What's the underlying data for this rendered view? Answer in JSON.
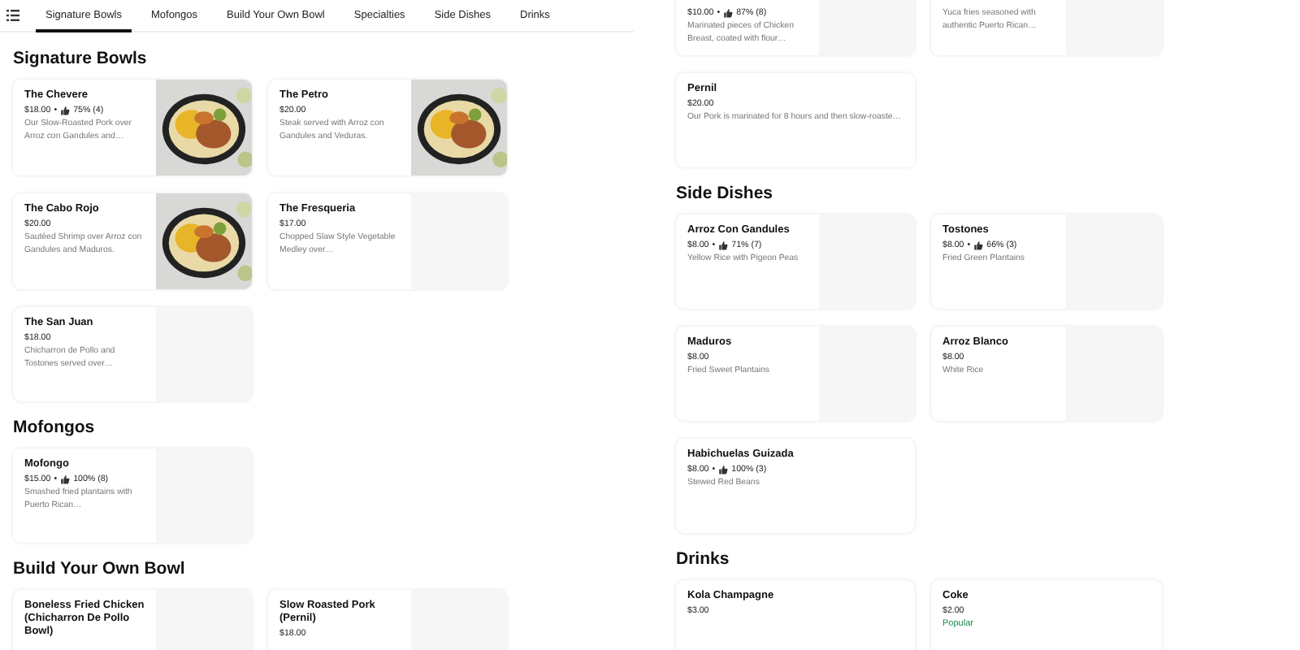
{
  "tabs": [
    {
      "label": "Signature Bowls",
      "selected": true
    },
    {
      "label": "Mofongos",
      "selected": false
    },
    {
      "label": "Build Your Own Bowl",
      "selected": false
    },
    {
      "label": "Specialties",
      "selected": false
    },
    {
      "label": "Side Dishes",
      "selected": false
    },
    {
      "label": "Drinks",
      "selected": false
    }
  ],
  "left_column": {
    "sections": [
      {
        "heading": "Signature Bowls",
        "items": [
          {
            "title": "The Chevere",
            "price": "$18.00",
            "separator": "•",
            "rating": "75% (4)",
            "description": "Our Slow-Roasted Pork over Arroz con Gandules and…"
          },
          {
            "title": "The Petro",
            "price": "$20.00",
            "description": "Steak served with Arroz con Gandules and Veduras."
          },
          {
            "title": "The Cabo Rojo",
            "price": "$20.00",
            "description": "Sautéed Shrimp over Arroz con Gandules and Maduros."
          },
          {
            "kind": "placeholder",
            "title": "The Fresqueria",
            "price": "$17.00",
            "description": "Chopped Slaw Style Vegetable Medley over…"
          },
          {
            "kind": "placeholder",
            "title": "The San Juan",
            "price": "$18.00",
            "description": "Chicharron de Pollo and Tostones served over…"
          }
        ]
      },
      {
        "heading": "Mofongos",
        "items": [
          {
            "kind": "placeholder",
            "title": "Mofongo",
            "price": "$15.00",
            "separator": "•",
            "rating": "100% (8)",
            "description": "Smashed fried plantains with Puerto Rican…"
          }
        ]
      },
      {
        "heading": "Build Your Own Bowl",
        "items": [
          {
            "kind": "placeholder",
            "title": "Boneless Fried Chicken (Chicharron De Pollo Bowl)"
          },
          {
            "kind": "placeholder",
            "title": "Slow Roasted Pork (Pernil)",
            "price": "$18.00"
          }
        ]
      }
    ]
  },
  "right_column": {
    "sections": [
      {
        "items": [
          {
            "kind": "placeholder",
            "price": "$10.00",
            "separator": "•",
            "rating": "87% (8)",
            "description": "Marinated pieces of Chicken Breast, coated with flour…"
          },
          {
            "kind": "placeholder",
            "description": "Yuca fries seasoned with authentic Puerto Rican…"
          },
          {
            "kind": "text",
            "title": "Pernil",
            "price": "$20.00",
            "description": "Our Pork is marinated for 8 hours and then slow-roaste…"
          }
        ]
      },
      {
        "heading": "Side Dishes",
        "items": [
          {
            "kind": "placeholder",
            "title": "Arroz Con Gandules",
            "price": "$8.00",
            "separator": "•",
            "rating": "71% (7)",
            "description": "Yellow Rice with Pigeon Peas"
          },
          {
            "kind": "placeholder",
            "title": "Tostones",
            "price": "$8.00",
            "separator": "•",
            "rating": "66% (3)",
            "description": "Fried Green Plantains"
          },
          {
            "kind": "placeholder",
            "title": "Maduros",
            "price": "$8.00",
            "description": "Fried Sweet Plantains"
          },
          {
            "kind": "placeholder",
            "title": "Arroz Blanco",
            "price": "$8.00",
            "description": "White Rice"
          },
          {
            "kind": "text",
            "title": "Habichuelas Guizada",
            "price": "$8.00",
            "separator": "•",
            "rating": "100% (3)",
            "description": "Stewed Red Beans"
          }
        ]
      },
      {
        "heading": "Drinks",
        "items": [
          {
            "kind": "text",
            "title": "Kola Champagne",
            "price": "$3.00"
          },
          {
            "kind": "text",
            "title": "Coke",
            "price": "$2.00",
            "badge": "Popular"
          }
        ]
      }
    ]
  }
}
